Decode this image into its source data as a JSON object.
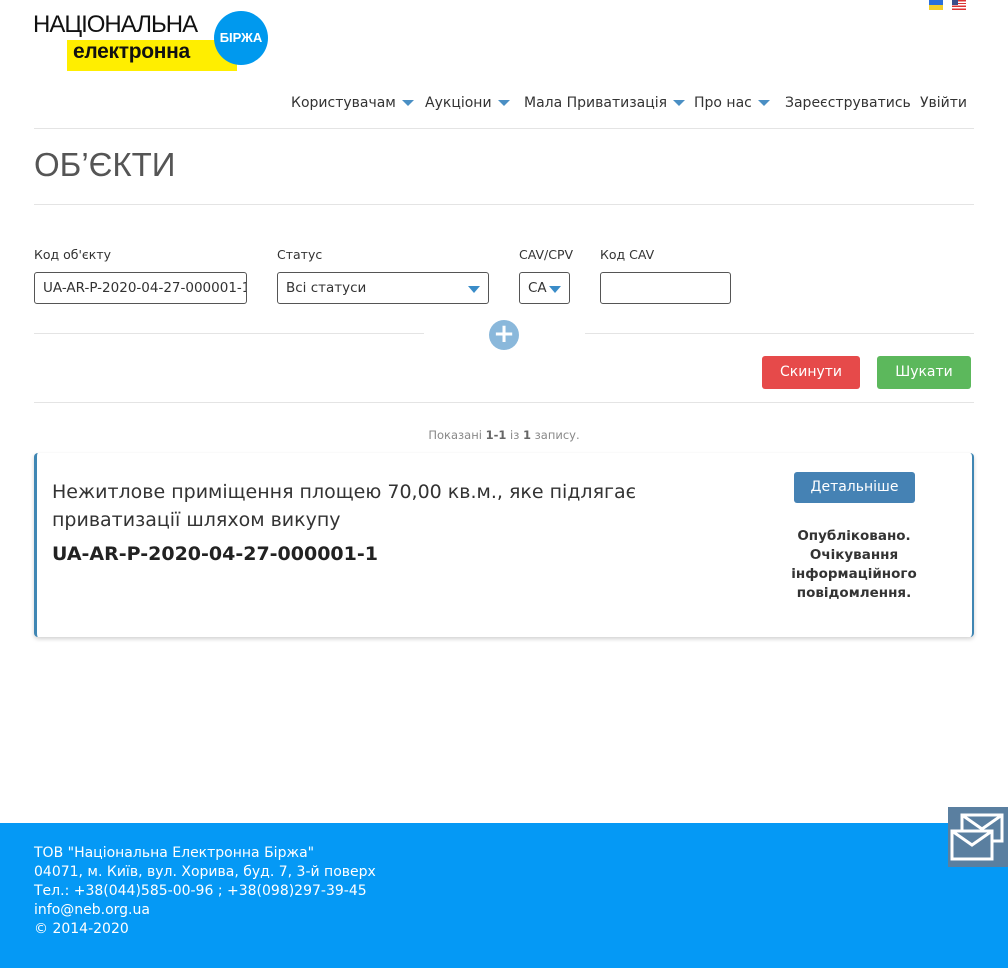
{
  "logo": {
    "line1": "НАЦІОНАЛЬНА",
    "line2": "електронна",
    "badge": "БІРЖА"
  },
  "languages": [
    {
      "name": "ua-flag-icon"
    },
    {
      "name": "us-flag-icon"
    }
  ],
  "nav": {
    "items": [
      {
        "label": "Користувачам",
        "dropdown": true
      },
      {
        "label": "Аукціони",
        "dropdown": true
      },
      {
        "label": "Мала Приватизація",
        "dropdown": true
      },
      {
        "label": "Про нас",
        "dropdown": true
      },
      {
        "label": "Зареєструватись",
        "dropdown": false
      },
      {
        "label": "Увійти",
        "dropdown": false
      }
    ]
  },
  "page": {
    "title": "ОБ’ЄКТИ"
  },
  "filters": {
    "object_code": {
      "label": "Код об'єкту",
      "value": "UA-AR-P-2020-04-27-000001-1"
    },
    "status": {
      "label": "Статус",
      "value": "Всі статуси"
    },
    "cav_cpv": {
      "label": "CAV/CPV",
      "value": "CA"
    },
    "cav_code": {
      "label": "Код CAV",
      "value": ""
    }
  },
  "actions": {
    "reset_label": "Скинути",
    "search_label": "Шукати"
  },
  "summary": {
    "prefix": "Показані",
    "range": "1-1",
    "middle": "із",
    "total": "1",
    "suffix": "запису."
  },
  "result": {
    "title": "Нежитлове приміщення площею 70,00 кв.м., яке підлягає приватизації шляхом викупу",
    "code": "UA-AR-P-2020-04-27-000001-1",
    "details_label": "Детальніше",
    "status": "Опубліковано. Очікування інформаційного повідомлення."
  },
  "footer": {
    "company": "ТОВ \"Національна Електронна Біржа\"",
    "address": "04071, м. Київ, вул. Хорива, буд. 7, 3-й поверх",
    "phones": "Тел.: +38(044)585-00-96 ; +38(098)297-39-45",
    "email": "info@neb.org.ua",
    "copyright": "© 2014-2020"
  },
  "colors": {
    "accent_blue": "#4582b4",
    "footer_bg": "#0599f5",
    "reset_red": "#e64a4a",
    "search_green": "#5cb85c",
    "logo_yellow": "#ffee00"
  }
}
